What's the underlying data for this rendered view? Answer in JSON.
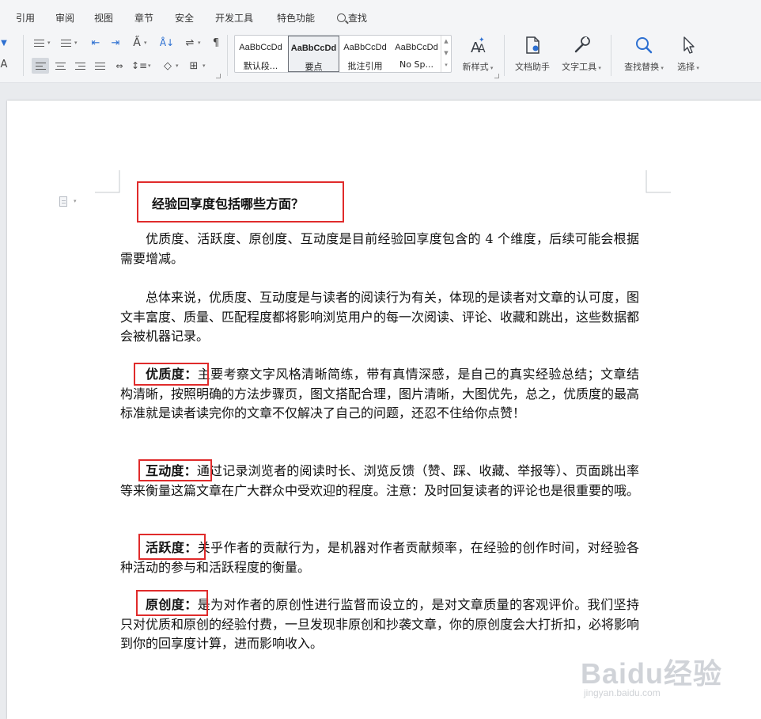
{
  "ribbon": {
    "tabs": [
      "引用",
      "审阅",
      "视图",
      "章节",
      "安全",
      "开发工具",
      "特色功能",
      "查找"
    ],
    "styles": [
      {
        "sample": "AaBbCcDd",
        "name": "默认段..."
      },
      {
        "sample": "AaBbCcDd",
        "name": "要点"
      },
      {
        "sample": "AaBbCcDd",
        "name": "批注引用"
      },
      {
        "sample": "AaBbCcDd",
        "name": "No Sp..."
      }
    ],
    "new_style": "新样式",
    "doc_assistant": "文档助手",
    "text_tools": "文字工具",
    "find_replace": "查找替换",
    "select": "选择"
  },
  "document": {
    "title": "经验回享度包括哪些方面？",
    "intro": "优质度、活跃度、原创度、互动度是目前经验回享度包含的 4 个维度，后续可能会根据需要增减。",
    "summary": "总体来说，优质度、互动度是与读者的阅读行为有关，体现的是读者对文章的认可度，图文丰富度、质量、匹配程度都将影响浏览用户的每一次阅读、评论、收藏和跳出，这些数据都会被机器记录。",
    "sections": [
      {
        "term": "优质度：",
        "text": "主要考察文字风格清晰简练，带有真情深感，是自己的真实经验总结；文章结构清晰，按照明确的方法步骤页，图文搭配合理，图片清晰，大图优先，总之，优质度的最高标准就是读者读完你的文章不仅解决了自己的问题，还忍不住给你点赞！"
      },
      {
        "term": "互动度：",
        "text": "通过记录浏览者的阅读时长、浏览反馈（赞、踩、收藏、举报等）、页面跳出率等来衡量这篇文章在广大群众中受欢迎的程度。注意：及时回复读者的评论也是很重要的哦。"
      },
      {
        "term": "活跃度：",
        "text": "关乎作者的贡献行为，是机器对作者贡献频率，在经验的创作时间，对经验各种活动的参与和活跃程度的衡量。"
      },
      {
        "term": "原创度：",
        "text": "是为对作者的原创性进行监督而设立的，是对文章质量的客观评价。我们坚持只对优质和原创的经验付费，一旦发现非原创和抄袭文章，你的原创度会大打折扣，必将影响到你的回享度计算，进而影响收入。"
      }
    ]
  },
  "watermark": {
    "main": "Baidu经验",
    "sub": "jingyan.baidu.com"
  },
  "colors": {
    "highlight_box": "#e02b2b",
    "ribbon_bg": "#f4f5f7",
    "page_bg": "#ffffff",
    "workspace_bg": "#e9ebee"
  }
}
